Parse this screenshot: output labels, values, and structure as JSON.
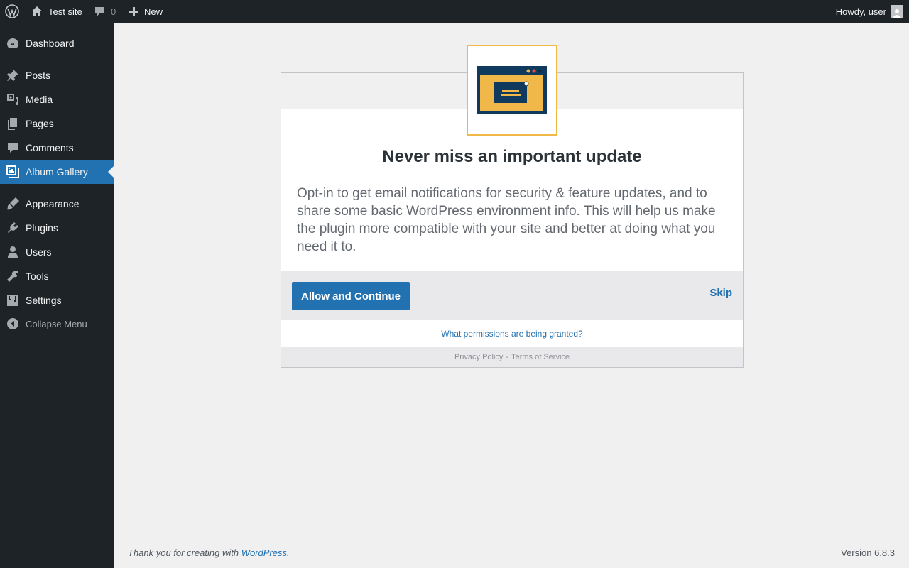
{
  "admin_bar": {
    "site_name": "Test site",
    "comments_count": "0",
    "new_label": "New",
    "howdy": "Howdy, user"
  },
  "sidebar": {
    "items": [
      {
        "label": "Dashboard",
        "icon": "dashboard-icon"
      },
      {
        "label": "Posts",
        "icon": "pin-icon"
      },
      {
        "label": "Media",
        "icon": "media-icon"
      },
      {
        "label": "Pages",
        "icon": "pages-icon"
      },
      {
        "label": "Comments",
        "icon": "comment-icon"
      },
      {
        "label": "Album Gallery",
        "icon": "gallery-icon",
        "current": true
      },
      {
        "label": "Appearance",
        "icon": "brush-icon"
      },
      {
        "label": "Plugins",
        "icon": "plug-icon"
      },
      {
        "label": "Users",
        "icon": "user-icon"
      },
      {
        "label": "Tools",
        "icon": "wrench-icon"
      },
      {
        "label": "Settings",
        "icon": "sliders-icon"
      }
    ],
    "collapse_label": "Collapse Menu"
  },
  "dialog": {
    "title": "Never miss an important update",
    "description": "Opt-in to get email notifications for security & feature updates, and to share some basic WordPress environment info. This will help us make the plugin more compatible with your site and better at doing what you need it to.",
    "allow_button": "Allow and Continue",
    "skip_button": "Skip",
    "permissions_link": "What permissions are being granted?",
    "privacy_link": "Privacy Policy",
    "separator": "-",
    "terms_link": "Terms of Service"
  },
  "footer": {
    "thanks_prefix": "Thank you for creating with ",
    "wordpress_link": "WordPress",
    "thanks_suffix": ".",
    "version": "Version 6.8.3"
  },
  "colors": {
    "admin_dark": "#1d2327",
    "accent_blue": "#2271b1",
    "icon_yellow": "#f0b849",
    "icon_navy": "#0f3a5e"
  }
}
